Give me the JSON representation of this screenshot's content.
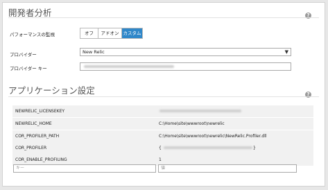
{
  "developer_analysis": {
    "title": "開発者分析",
    "performance_monitoring_label": "パフォーマンスの監視",
    "toggle_options": [
      "オフ",
      "アドオン",
      "カスタム"
    ],
    "toggle_selected": "カスタム",
    "provider_label": "プロバイダー",
    "provider_value": "New Relic",
    "provider_key_label": "プロバイダー キー"
  },
  "app_settings": {
    "title": "アプリケーション設定",
    "rows": [
      {
        "key": "NEWRELIC_LICENSEKEY",
        "value": ""
      },
      {
        "key": "NEWRELIC_HOME",
        "value": "C:\\Home\\site\\wwwroot\\newrelic"
      },
      {
        "key": "COR_PROFILER_PATH",
        "value": "C:\\Home\\site\\wwwroot\\newrelic\\NewRelic.Profiler.dll"
      },
      {
        "key": "COR_PROFILER",
        "value": "{"
      },
      {
        "key": "COR_ENABLE_PROFILING",
        "value": "1"
      }
    ],
    "new_key_placeholder": "キー",
    "new_value_placeholder": "値"
  },
  "icons": {
    "help": "question-mark-icon",
    "dropdown": "chevron-down-icon"
  },
  "colors": {
    "accent": "#2f87c9",
    "row_background": "#f1f1f1"
  }
}
